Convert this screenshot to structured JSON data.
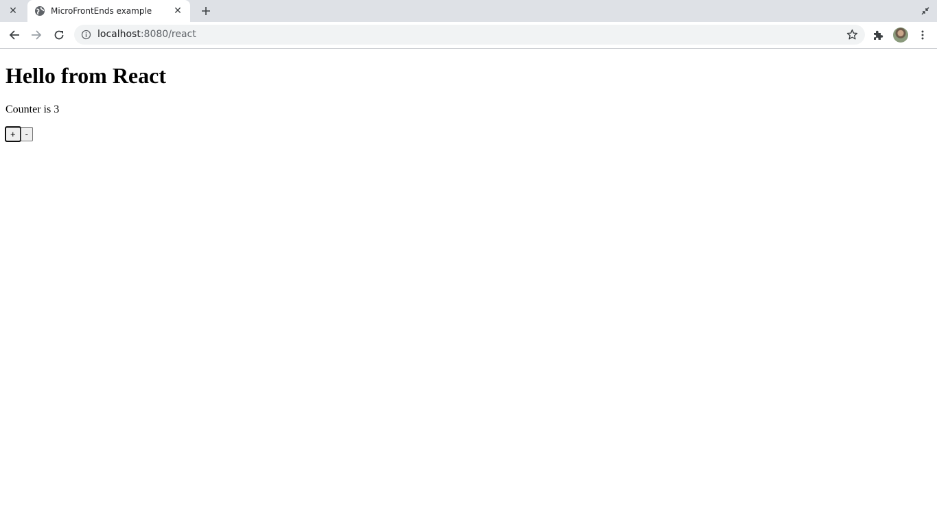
{
  "browser": {
    "tabs": [
      {
        "title": "",
        "active": false
      },
      {
        "title": "MicroFrontEnds example",
        "active": true
      }
    ],
    "address": {
      "host": "localhost",
      "path": ":8080/react"
    },
    "icons": {
      "inactive_tab_close": "close-icon",
      "active_tab_favicon": "globe-icon",
      "active_tab_close": "close-icon",
      "new_tab": "plus-icon",
      "window_control": "minimize-icon",
      "back": "arrow-left-icon",
      "forward": "arrow-right-icon",
      "reload": "reload-icon",
      "site_info": "info-icon",
      "bookmark": "star-icon",
      "extensions": "puzzle-icon",
      "profile": "avatar",
      "menu": "kebab-menu-icon"
    },
    "glyphs": {
      "close": "✕",
      "minus": "-",
      "plus": "+"
    }
  },
  "page": {
    "heading": "Hello from React",
    "counter_text": "Counter is 3",
    "buttons": {
      "increment": "+",
      "decrement": "-"
    }
  }
}
